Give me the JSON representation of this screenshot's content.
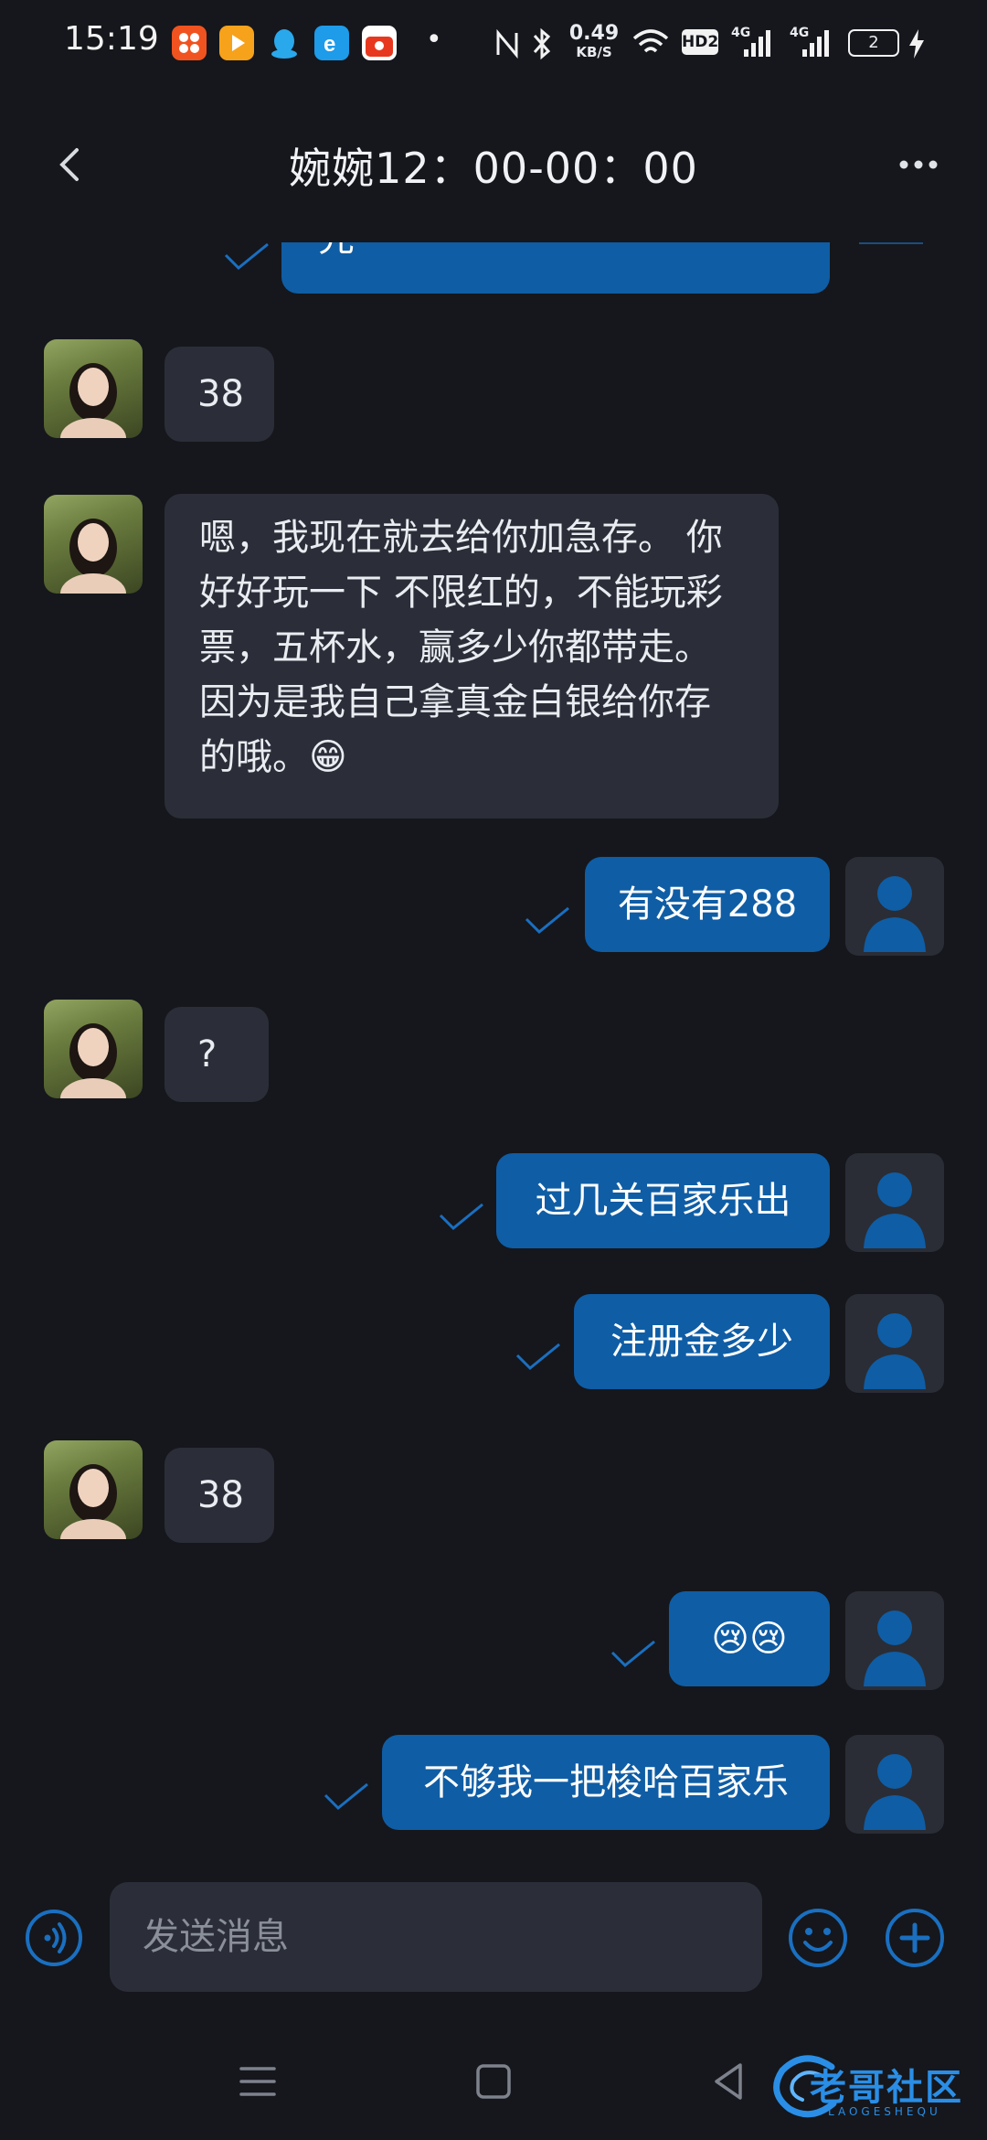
{
  "status_bar": {
    "time": "15:19",
    "dot": "•",
    "network_speed_value": "0.49",
    "network_speed_unit": "KB/S",
    "hd_label": "HD2",
    "signal1_label": "4G",
    "signal2_label": "4G",
    "battery_level": "2",
    "icons": [
      "app-orange-icon",
      "video-app-icon",
      "qq-penguin-icon",
      "browser-e-icon",
      "shopping-app-icon",
      "nfc-icon",
      "bluetooth-icon",
      "wifi-icon",
      "charging-bolt-icon"
    ]
  },
  "header": {
    "title": "婉婉12：00-00：00",
    "back_icon": "chevron-left-icon",
    "more_icon": "more-dots-icon"
  },
  "messages": [
    {
      "sender": "self",
      "text": "先",
      "partial": true
    },
    {
      "sender": "other",
      "text": "38"
    },
    {
      "sender": "other",
      "lines": [
        "嗯，我现在就去给你加急存。 你",
        "好好玩一下 不限红的，不能玩彩",
        "票，五杯水，赢多少你都带走。",
        "因为是我自己拿真金白银给你存",
        "的哦。😁"
      ]
    },
    {
      "sender": "self",
      "text": "有没有288"
    },
    {
      "sender": "other",
      "text": "?"
    },
    {
      "sender": "self",
      "text": "过几关百家乐出"
    },
    {
      "sender": "self",
      "text": "注册金多少"
    },
    {
      "sender": "other",
      "text": "38"
    },
    {
      "sender": "self",
      "text": "😢😢"
    },
    {
      "sender": "self",
      "text": "不够我一把梭哈百家乐"
    }
  ],
  "input_bar": {
    "placeholder": "发送消息",
    "voice_icon": "voice-icon",
    "emoji_icon": "emoji-icon",
    "add_icon": "plus-circle-icon"
  },
  "nav_bar": {
    "menu_icon": "menu-icon",
    "home_icon": "home-square-icon",
    "back_icon": "back-triangle-icon"
  },
  "watermark": {
    "text": "老哥社区",
    "subtext": "LAOGESHEQU"
  },
  "colors": {
    "background": "#15171c",
    "incoming_bubble": "#2b2e38",
    "outgoing_bubble": "#0f5da5",
    "accent": "#1a6fc0"
  }
}
